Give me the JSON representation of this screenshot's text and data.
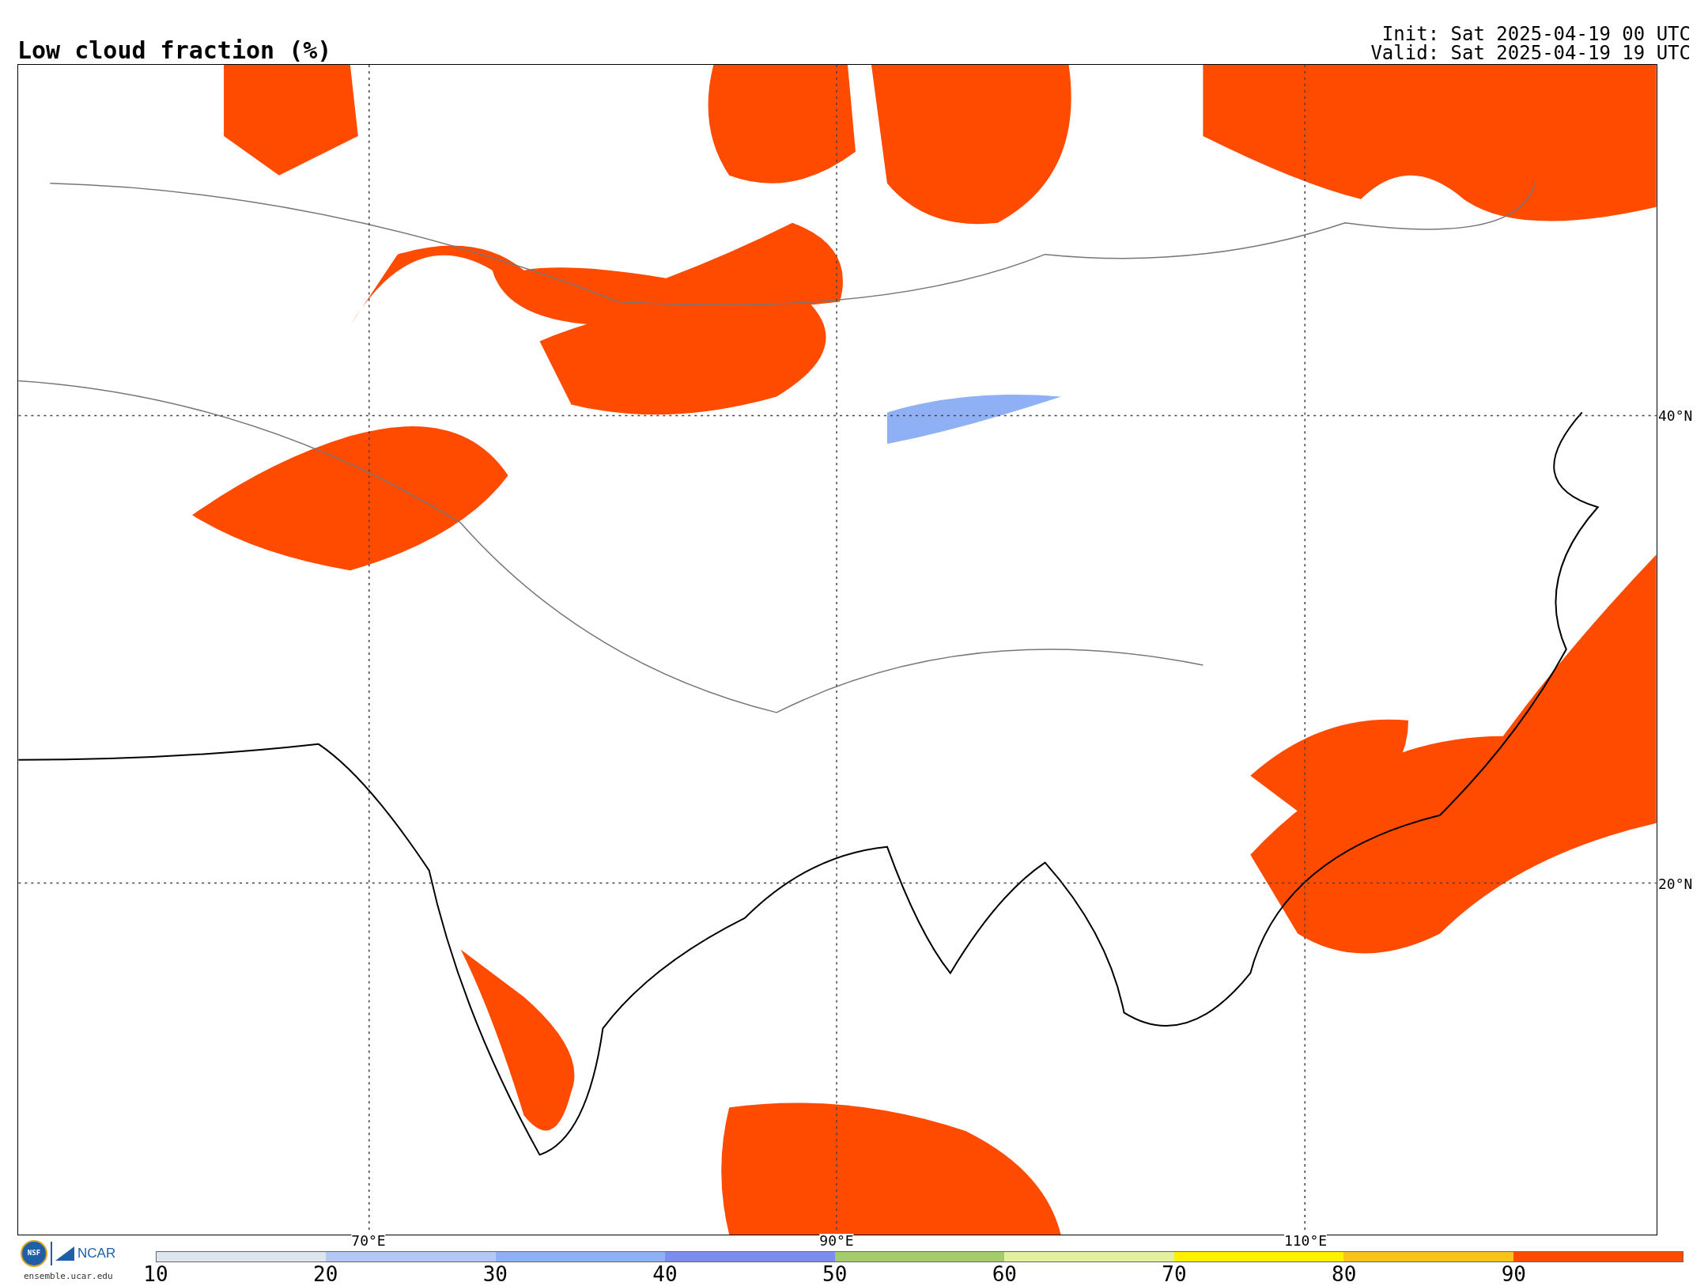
{
  "title": "Low cloud fraction (%)",
  "init": "Init: Sat 2025-04-19 00 UTC",
  "valid": "Valid: Sat 2025-04-19 19 UTC",
  "map": {
    "latitude_labels": [
      "40°N",
      "20°N"
    ],
    "longitude_labels": [
      "70°E",
      "90°E",
      "110°E"
    ]
  },
  "logos": {
    "nsf": "NSF",
    "ncar": "NCAR",
    "url": "ensemble.ucar.edu"
  },
  "colorbar": {
    "segments": [
      {
        "color": "#dde6ef"
      },
      {
        "color": "#b4c8f5"
      },
      {
        "color": "#8fb0f5"
      },
      {
        "color": "#7b8ef0"
      },
      {
        "color": "#a5cc6a"
      },
      {
        "color": "#e2f0a0"
      },
      {
        "color": "#fff000"
      },
      {
        "color": "#f8c41c"
      },
      {
        "color": "#ff4b00"
      }
    ],
    "ticks": [
      "10",
      "20",
      "30",
      "40",
      "50",
      "60",
      "70",
      "80",
      "90"
    ]
  }
}
